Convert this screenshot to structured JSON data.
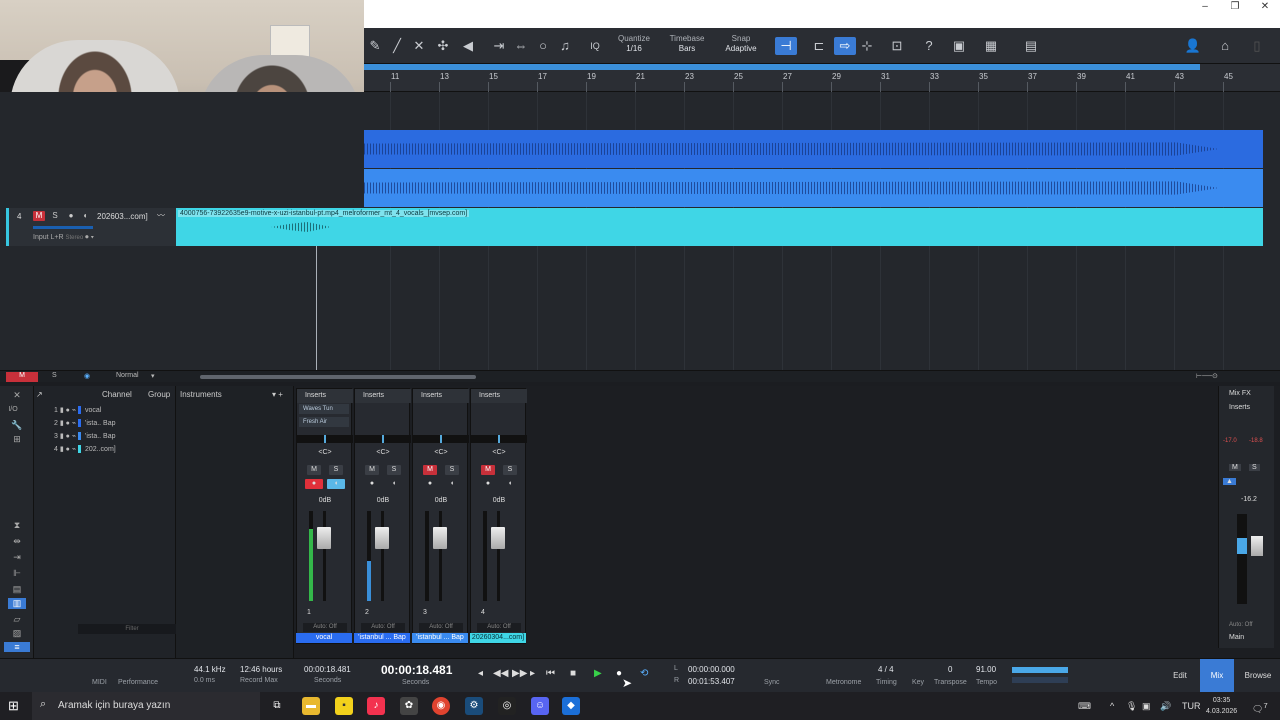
{
  "window": {
    "controls": [
      "–",
      "❐",
      "✕"
    ]
  },
  "toolbar": {
    "quantize": {
      "label": "Quantize",
      "value": "1/16"
    },
    "timebase": {
      "label": "Timebase",
      "value": "Bars"
    },
    "snap": {
      "label": "Snap",
      "value": "Adaptive"
    },
    "iq_label": "IQ",
    "help_label": "?"
  },
  "ruler": {
    "bars": [
      "11",
      "13",
      "15",
      "17",
      "19",
      "21",
      "23",
      "25",
      "27",
      "29",
      "31",
      "33",
      "35",
      "37",
      "39",
      "41",
      "43",
      "45"
    ]
  },
  "track4": {
    "number": "4",
    "mute": "M",
    "solo": "S",
    "name": "202603...com]",
    "input": "Input L+R",
    "input_mode": "Stereo",
    "clip_label": "4000756-73922635e9-motive-x-uzi-istanbul-pt.mp4_melroformer_mt_4_vocals_[mvsep.com]"
  },
  "arrange_footer": {
    "m": "M",
    "s": "S",
    "mode": "Normal"
  },
  "channel_list": {
    "headers": {
      "channel": "Channel",
      "group": "Group",
      "instruments": "Instruments"
    },
    "io_label": "I/O",
    "rows": [
      {
        "num": "1",
        "name": "vocal",
        "color": "#2a6cf0"
      },
      {
        "num": "2",
        "name": "'ista.. Bap",
        "color": "#2a6cf0"
      },
      {
        "num": "3",
        "name": "'ista.. Bap",
        "color": "#3a8bf0"
      },
      {
        "num": "4",
        "name": "202..com]",
        "color": "#3fd6e6"
      }
    ],
    "filter_placeholder": "Filter"
  },
  "strips": [
    {
      "num": "1",
      "inserts": "Inserts",
      "plugins": [
        "Waves Tun",
        "Fresh Air"
      ],
      "pan": "<C>",
      "mute": "M",
      "solo": "S",
      "mute_on": false,
      "db": "0dB",
      "auto": "Auto: Off",
      "name": "vocal",
      "name_color": "#2a6cf0",
      "meter_level": 0.8
    },
    {
      "num": "2",
      "inserts": "Inserts",
      "plugins": [],
      "pan": "<C>",
      "mute": "M",
      "solo": "S",
      "mute_on": false,
      "db": "0dB",
      "auto": "Auto: Off",
      "name": "'istanbul ... Bap",
      "name_color": "#2a6cf0",
      "meter_level": 0.45
    },
    {
      "num": "3",
      "inserts": "Inserts",
      "plugins": [],
      "pan": "<C>",
      "mute": "M",
      "solo": "S",
      "mute_on": true,
      "db": "0dB",
      "auto": "Auto: Off",
      "name": "'istanbul ... Bap",
      "name_color": "#3a8bf0",
      "meter_level": 0
    },
    {
      "num": "4",
      "inserts": "Inserts",
      "plugins": [],
      "pan": "<C>",
      "mute": "M",
      "solo": "S",
      "mute_on": true,
      "db": "0dB",
      "auto": "Auto: Off",
      "name": "20260304...com]",
      "name_color": "#3fd6e6",
      "meter_level": 0
    }
  ],
  "main_strip": {
    "mixfx": "Mix FX",
    "inserts": "Inserts",
    "peak_l": "-17.0",
    "peak_r": "-18.8",
    "mute": "M",
    "solo": "S",
    "db": "-16.2",
    "auto": "Auto: Off",
    "name": "Main"
  },
  "transport": {
    "midi": "MIDI",
    "performance": "Performance",
    "sample_rate": "44.1 kHz",
    "latency": "0.0 ms",
    "record_max_value": "12:46 hours",
    "record_max_label": "Record Max",
    "seconds_small": "00:00:18.481",
    "seconds_label": "Seconds",
    "time_big": "00:00:18.481",
    "time_big_label": "Seconds",
    "loop_l_label": "L",
    "loop_l": "00:00:00.000",
    "loop_r_label": "R",
    "loop_r": "00:01:53.407",
    "sync": "Sync",
    "metronome": "Metronome",
    "timing_value": "4 / 4",
    "timing_label": "Timing",
    "key_label": "Key",
    "transpose_value": "0",
    "transpose_label": "Transpose",
    "tempo_value": "91.00",
    "tempo_label": "Tempo",
    "tabs": {
      "edit": "Edit",
      "mix": "Mix",
      "browse": "Browse"
    }
  },
  "taskbar": {
    "search_placeholder": "Aramak için buraya yazın",
    "lang": "TUR",
    "time": "03:35",
    "date": "4.03.2026",
    "notifications": "7"
  }
}
